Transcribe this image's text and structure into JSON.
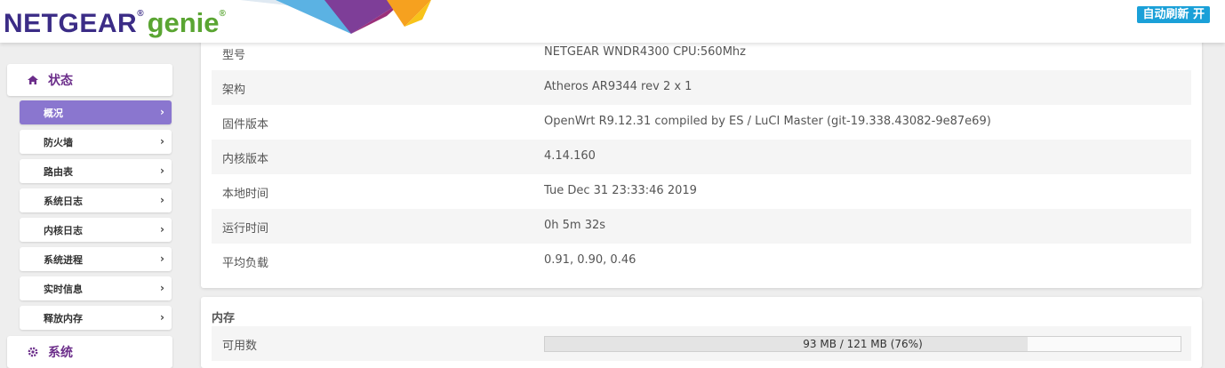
{
  "header": {
    "logo_brand": "NETGEAR",
    "logo_product": "genie",
    "logo_reg": "®",
    "refresh_button": "自动刷新 开"
  },
  "sidebar": {
    "status_section": "状态",
    "system_section": "系统",
    "items": [
      {
        "label": "概况",
        "active": true
      },
      {
        "label": "防火墙",
        "active": false
      },
      {
        "label": "路由表",
        "active": false
      },
      {
        "label": "系统日志",
        "active": false
      },
      {
        "label": "内核日志",
        "active": false
      },
      {
        "label": "系统进程",
        "active": false
      },
      {
        "label": "实时信息",
        "active": false
      },
      {
        "label": "释放内存",
        "active": false
      }
    ],
    "chevron": "›"
  },
  "system_info": {
    "rows": [
      {
        "key": "型号",
        "value": "NETGEAR WNDR4300 CPU:560Mhz"
      },
      {
        "key": "架构",
        "value": "Atheros AR9344 rev 2 x 1"
      },
      {
        "key": "固件版本",
        "value": "OpenWrt R9.12.31 compiled by ES / LuCI Master (git-19.338.43082-9e87e69)"
      },
      {
        "key": "内核版本",
        "value": "4.14.160"
      },
      {
        "key": "本地时间",
        "value": "Tue Dec 31 23:33:46 2019"
      },
      {
        "key": "运行时间",
        "value": "0h 5m 32s"
      },
      {
        "key": "平均负载",
        "value": "0.91, 0.90, 0.46"
      }
    ]
  },
  "memory": {
    "title": "内存",
    "available_label": "可用数",
    "available_text": "93 MB / 121 MB (76%)",
    "available_fraction": 0.76
  },
  "colors": {
    "accent_purple": "#6b2d8a",
    "active_item": "#8a76cf",
    "refresh_blue": "#1aa0d8",
    "netgear_blue": "#3b2c86",
    "genie_green": "#5aa532"
  },
  "icons": {
    "status": "home-icon",
    "system": "gear-icon"
  }
}
